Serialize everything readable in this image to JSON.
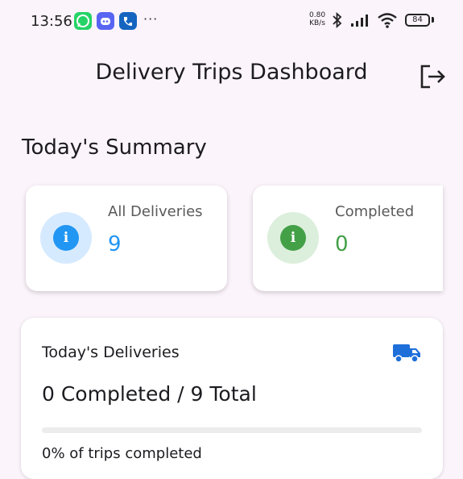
{
  "status_bar": {
    "time": "13:56",
    "net_speed_value": "0.80",
    "net_speed_unit": "KB/s",
    "overflow": "···",
    "battery": "84",
    "notification_icons": [
      "whatsapp-icon",
      "discord-icon",
      "phone-app-icon"
    ]
  },
  "app_bar": {
    "title": "Delivery Trips Dashboard",
    "action_icon": "logout-icon"
  },
  "summary": {
    "title": "Today's Summary",
    "cards": [
      {
        "label": "All Deliveries",
        "value": "9",
        "icon": "info-icon",
        "color": "#2196f3",
        "bg": "#d6eaff"
      },
      {
        "label": "Completed",
        "value": "0",
        "icon": "info-icon",
        "color": "#43a047",
        "bg": "#dcefdc"
      }
    ]
  },
  "deliveries": {
    "title": "Today's Deliveries",
    "icon": "truck-icon",
    "count_text": "0 Completed / 9 Total",
    "progress_fraction": 0,
    "progress_text": "0% of trips completed"
  }
}
